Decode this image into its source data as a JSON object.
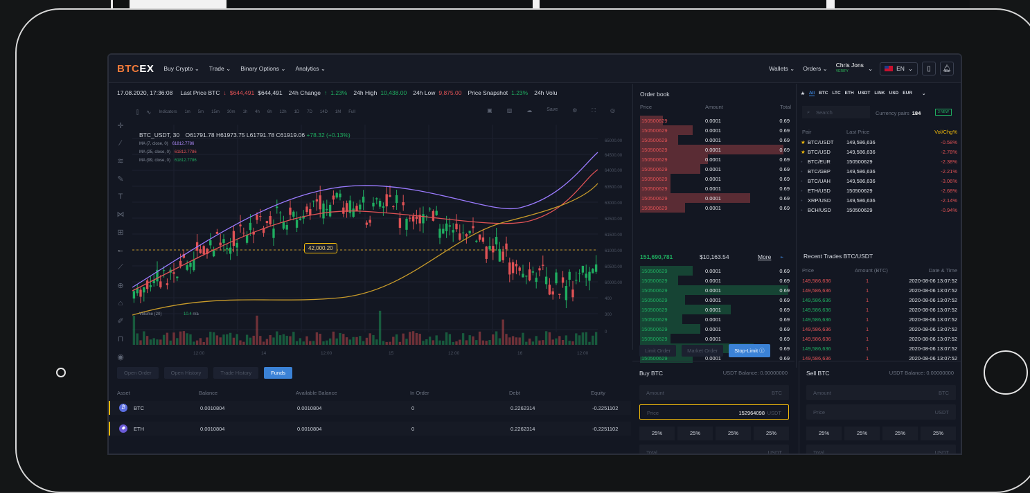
{
  "nav": {
    "brand_a": "BTC",
    "brand_b": "EX",
    "menu": [
      "Buy Crypto ⌄",
      "Trade ⌄",
      "Binary Options ⌄",
      "Analytics ⌄"
    ],
    "wallets": "Wallets ⌄",
    "orders": "Orders ⌄",
    "user_name": "Chris Jons",
    "user_status": "VERIFY",
    "lang": "EN",
    "lang_chevron": "⌄",
    "user_chevron": "⌄"
  },
  "ticker": {
    "datetime": "17.08.2020, 17:36:08",
    "last_price_label": "Last Price BTC",
    "last_price_arrow": "↓",
    "last_price_red": "$644,491",
    "last_price": "$644,491",
    "change_label": "24h Change",
    "change_arrow": "↑",
    "change": "1.23%",
    "high_label": "24h High",
    "high": "10,438.00",
    "low_label": "24h Low",
    "low": "9,875.00",
    "snapshot_label": "Price Snapshot",
    "snapshot": "1.23%",
    "vol_label": "24h Volu"
  },
  "chart_toolbar": {
    "indicators": "Indicators",
    "intervals": [
      "1m",
      "5m",
      "15m",
      "30m",
      "1h",
      "4h",
      "6h",
      "12h",
      "1D",
      "7D",
      "14D",
      "1M",
      "Full"
    ],
    "save": "Save"
  },
  "chart_overlay": {
    "symbol": "BTC_USDT, 30",
    "o": "O61791.78",
    "h": "H61973.75",
    "l": "L61791.78",
    "c": "C61919.06",
    "chg": "+78.32 (+0.13%)",
    "ma": [
      {
        "label": "MA (7, close, 0)",
        "value": "61812.7786",
        "color": "#b18cff"
      },
      {
        "label": "MA (25, close, 0)",
        "value": "61812.7786",
        "color": "#e05255"
      },
      {
        "label": "MA (99, close, 0)",
        "value": "61812.7786",
        "color": "#1fad60"
      }
    ],
    "price_box": "42,000.20",
    "volume_label": "Volume (20)",
    "volume_value": "10.4",
    "volume_na": "n/a"
  },
  "y_axis": [
    "65000.00",
    "64500.00",
    "64000.00",
    "63500.00",
    "63000.00",
    "62500.00",
    "61500.00",
    "61000.00",
    "60500.00",
    "60000.00",
    "400",
    "300",
    "0"
  ],
  "x_axis": [
    "12:00",
    "14",
    "12:00",
    "15",
    "12:00",
    "16",
    "12:00"
  ],
  "bottom_tabs": [
    "Open Order",
    "Open History",
    "Trade History",
    "Funds"
  ],
  "funds": {
    "headers": [
      "Asset",
      "Balance",
      "Available Balance",
      "In Order",
      "Debt",
      "Equity"
    ],
    "rows": [
      {
        "asset": "BTC",
        "icon": "₿",
        "color": "#5b6ee1",
        "balance": "0.0010804",
        "available": "0.0010804",
        "in_order": "0",
        "debt": "0.2262314",
        "equity": "-0.2251102"
      },
      {
        "asset": "ETH",
        "icon": "◆",
        "color": "#6b5bd6",
        "balance": "0.0010804",
        "available": "0.0010804",
        "in_order": "0",
        "debt": "0.2262314",
        "equity": "-0.2251102"
      }
    ]
  },
  "orderbook": {
    "title": "Order book",
    "headers": [
      "Price",
      "Amount",
      "Total"
    ],
    "asks": [
      {
        "price": "150500629",
        "amount": "0.0001",
        "total": "0.69",
        "depth": 0.15
      },
      {
        "price": "150500629",
        "amount": "0.0001",
        "total": "0.69",
        "depth": 0.35
      },
      {
        "price": "150500629",
        "amount": "0.0001",
        "total": "0.69",
        "depth": 0.25
      },
      {
        "price": "150500629",
        "amount": "0.0001",
        "total": "0.69",
        "depth": 0.95
      },
      {
        "price": "150500629",
        "amount": "0.0001",
        "total": "0.69",
        "depth": 0.45
      },
      {
        "price": "150500629",
        "amount": "0.0001",
        "total": "0.69",
        "depth": 0.4
      },
      {
        "price": "150500629",
        "amount": "0.0001",
        "total": "0.69",
        "depth": 0.2
      },
      {
        "price": "150500629",
        "amount": "0.0001",
        "total": "0.69",
        "depth": 0.2
      },
      {
        "price": "150500629",
        "amount": "0.0001",
        "total": "0.69",
        "depth": 0.73
      },
      {
        "price": "150500629",
        "amount": "0.0001",
        "total": "0.69",
        "depth": 0.3
      }
    ],
    "mid_price": "151,690,781",
    "mid_usd": "$10,163.54",
    "more": "More",
    "bids": [
      {
        "price": "150500629",
        "amount": "0.0001",
        "total": "0.69",
        "depth": 0.35
      },
      {
        "price": "150500629",
        "amount": "0.0001",
        "total": "0.69",
        "depth": 0.25
      },
      {
        "price": "150500629",
        "amount": "0.0001",
        "total": "0.69",
        "depth": 0.98
      },
      {
        "price": "150500629",
        "amount": "0.0001",
        "total": "0.69",
        "depth": 0.3
      },
      {
        "price": "150500629",
        "amount": "0.0001",
        "total": "0.69",
        "depth": 0.6
      },
      {
        "price": "150500629",
        "amount": "0.0001",
        "total": "0.69",
        "depth": 0.28
      },
      {
        "price": "150500629",
        "amount": "0.0001",
        "total": "0.69",
        "depth": 0.4
      },
      {
        "price": "150500629",
        "amount": "0.0001",
        "total": "0.69",
        "depth": 0.2
      },
      {
        "price": "150500629",
        "amount": "0.0001",
        "total": "0.69",
        "depth": 0.75
      },
      {
        "price": "150500629",
        "amount": "0.0001",
        "total": "0.69",
        "depth": 0.35
      }
    ]
  },
  "order_tabs": [
    "Limit Order",
    "Market Order",
    "Stop-Limit"
  ],
  "pairs": {
    "tabs": [
      "★",
      "All",
      "BTC",
      "LTC",
      "ETH",
      "USDT",
      "LINK",
      "USD",
      "EUR"
    ],
    "search": "Search",
    "count_label": "Currency pairs",
    "count": "184",
    "new_badge": "3 NEW",
    "headers": [
      "Pair",
      "Last Price",
      "Vol/Chg%"
    ],
    "rows": [
      {
        "pair": "BTC/USDT",
        "price": "149,586,636",
        "chg": "-0.58%",
        "fav": true
      },
      {
        "pair": "BTC/USD",
        "price": "149,586,636",
        "chg": "-2.78%",
        "fav": true
      },
      {
        "pair": "BTC/EUR",
        "price": "150500629",
        "chg": "-2.38%",
        "fav": false
      },
      {
        "pair": "BTC/GBP",
        "price": "149,586,636",
        "chg": "-2.21%",
        "fav": false
      },
      {
        "pair": "BTC/UAH",
        "price": "149,586,636",
        "chg": "-3.06%",
        "fav": false
      },
      {
        "pair": "ETH/USD",
        "price": "150500629",
        "chg": "-2.68%",
        "fav": false
      },
      {
        "pair": "XRP/USD",
        "price": "149,586,636",
        "chg": "-2.14%",
        "fav": false
      },
      {
        "pair": "BCH/USD",
        "price": "150500629",
        "chg": "-0.94%",
        "fav": false
      }
    ]
  },
  "recent": {
    "title": "Recent Trades BTC/USDT",
    "headers": [
      "Price",
      "Amount (BTC)",
      "Date & Time"
    ],
    "rows": [
      {
        "price": "149,586,636",
        "amount": "1",
        "time": "2020-08-06 13:07:52",
        "side": "sell"
      },
      {
        "price": "149,586,636",
        "amount": "1",
        "time": "2020-08-06 13:07:52",
        "side": "sell"
      },
      {
        "price": "149,586,636",
        "amount": "1",
        "time": "2020-08-06 13:07:52",
        "side": "buy"
      },
      {
        "price": "149,586,636",
        "amount": "1",
        "time": "2020-08-06 13:07:52",
        "side": "buy"
      },
      {
        "price": "149,586,636",
        "amount": "1",
        "time": "2020-08-06 13:07:52",
        "side": "buy"
      },
      {
        "price": "149,586,636",
        "amount": "1",
        "time": "2020-08-06 13:07:52",
        "side": "sell"
      },
      {
        "price": "149,586,636",
        "amount": "1",
        "time": "2020-08-06 13:07:52",
        "side": "sell"
      },
      {
        "price": "149,586,636",
        "amount": "1",
        "time": "2020-08-06 13:07:52",
        "side": "buy"
      },
      {
        "price": "149,586,636",
        "amount": "1",
        "time": "2020-08-06 13:07:52",
        "side": "sell"
      }
    ]
  },
  "buy": {
    "title": "Buy BTC",
    "balance": "USDT Balance: 0.00000000",
    "amount_label": "Amount",
    "amount_unit": "BTC",
    "price_label": "Price",
    "price_value": "152964098",
    "price_unit": "USDT",
    "pcts": [
      "25%",
      "25%",
      "25%",
      "25%"
    ],
    "total_label": "Total",
    "total_unit": "USDT"
  },
  "sell": {
    "title": "Sell BTC",
    "balance": "USDT Balance: 0.00000000",
    "amount_label": "Amount",
    "amount_unit": "BTC",
    "price_label": "Price",
    "price_unit": "USDT",
    "pcts": [
      "25%",
      "25%",
      "25%",
      "25%"
    ],
    "total_label": "Total",
    "total_unit": "USDT"
  },
  "colors": {
    "accent": "#3b82d6",
    "up": "#1fad60",
    "down": "#e05255",
    "brand": "#f07a3a"
  }
}
